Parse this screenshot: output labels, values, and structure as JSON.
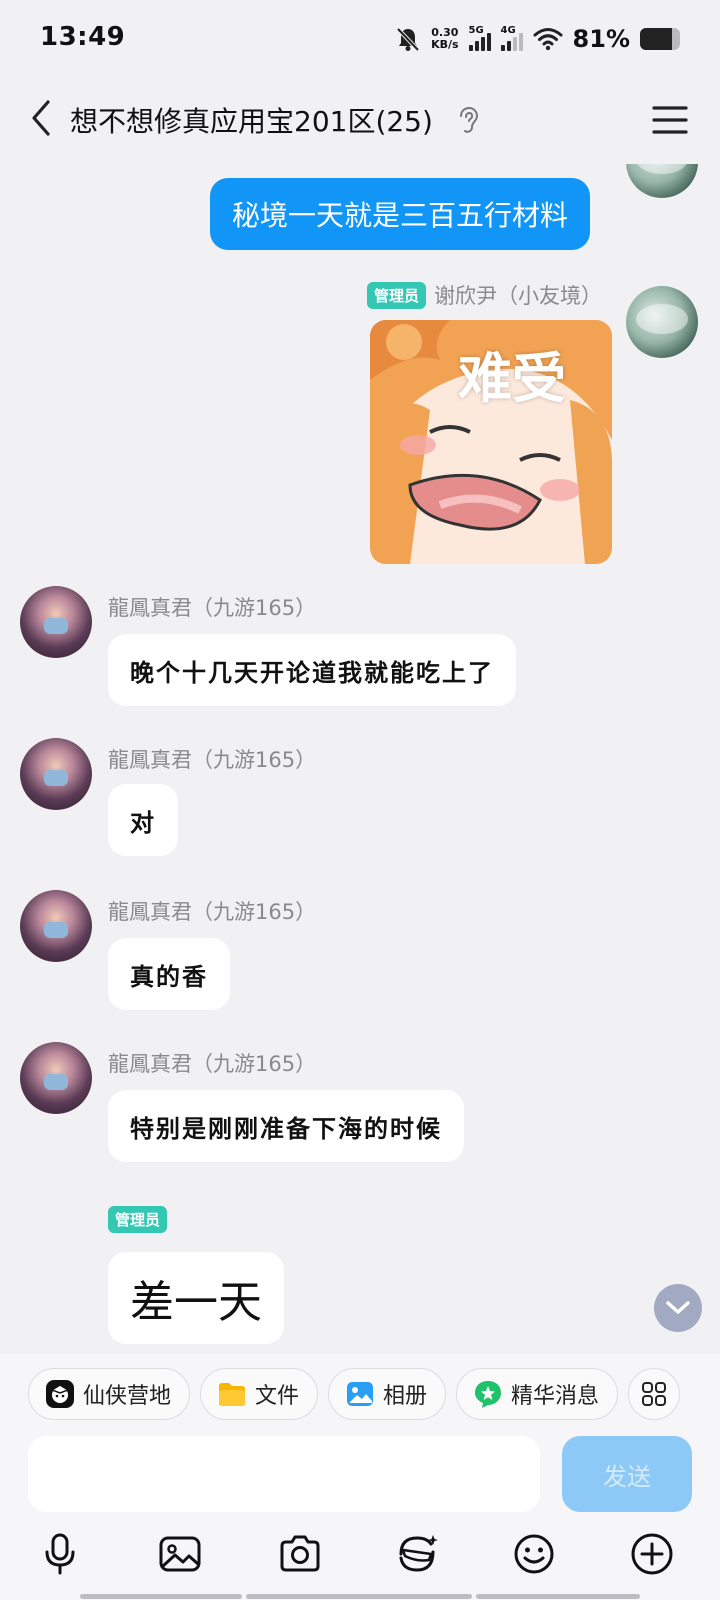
{
  "status_bar": {
    "time": "13:49",
    "net_speed_value": "0.30",
    "net_speed_unit": "KB/s",
    "sim1_label": "5G",
    "sim2_label": "4G",
    "battery_percent": "81%",
    "battery_level": 0.81
  },
  "header": {
    "title": "想不想修真应用宝201区(25)"
  },
  "messages": [
    {
      "type": "self_text",
      "text": "秘境一天就是三百五行材料"
    },
    {
      "type": "self_sticker",
      "badge": "管理员",
      "sender": "谢欣尹（小友境）",
      "sticker_text": "难受"
    },
    {
      "type": "other_text",
      "sender": "龍鳳真君（九游165）",
      "text": "晚个十几天开论道我就能吃上了"
    },
    {
      "type": "other_text",
      "sender": "龍鳳真君（九游165）",
      "text": "对"
    },
    {
      "type": "other_text",
      "sender": "龍鳳真君（九游165）",
      "text": "真的香"
    },
    {
      "type": "other_text",
      "sender": "龍鳳真君（九游165）",
      "text": "特别是刚刚准备下海的时候"
    },
    {
      "type": "other_text",
      "badge": "管理员",
      "text": "差一天"
    }
  ],
  "quick_bar": [
    {
      "label": "仙侠营地",
      "icon": "camp-icon"
    },
    {
      "label": "文件",
      "icon": "folder-icon"
    },
    {
      "label": "相册",
      "icon": "album-icon"
    },
    {
      "label": "精华消息",
      "icon": "star-icon"
    }
  ],
  "input": {
    "value": "",
    "send_label": "发送"
  },
  "toolbar": [
    "mic-icon",
    "image-icon",
    "camera-icon",
    "sticker-icon",
    "emoji-icon",
    "plus-icon"
  ],
  "colors": {
    "self_bubble": "#1195f7",
    "badge": "#34c7b3",
    "send_disabled": "#8cc9f7",
    "background": "#f1f1f4"
  }
}
